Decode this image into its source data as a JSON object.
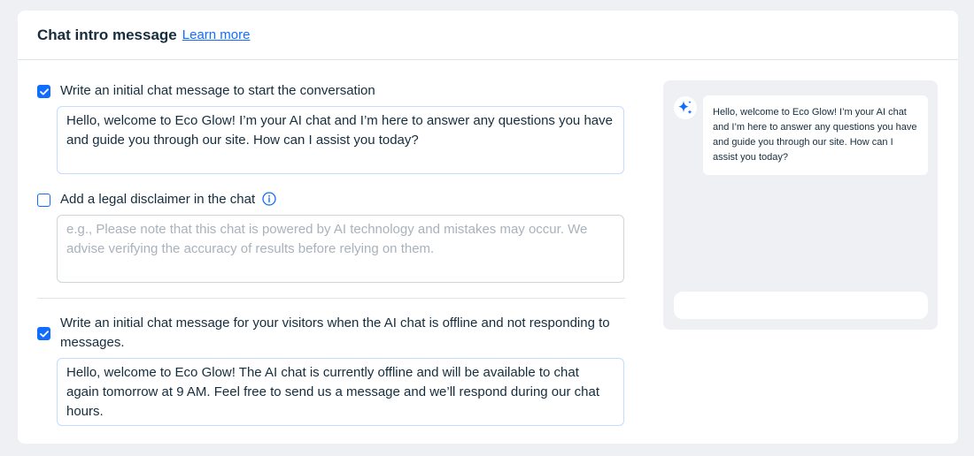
{
  "header": {
    "title": "Chat intro message",
    "learn_more": "Learn more"
  },
  "options": [
    {
      "label": "Write an initial chat message to start the conversation",
      "checked": true,
      "value": "Hello, welcome to Eco Glow! I’m your AI chat and I’m here to answer any questions you have and guide you through our site. How can I assist you today?"
    },
    {
      "label": "Add a legal disclaimer in the chat",
      "checked": false,
      "placeholder": "e.g., Please note that this chat is powered by AI technology and mistakes may occur. We advise verifying the accuracy of results before relying on them."
    },
    {
      "label": "Write an initial chat message for your visitors when the AI chat is offline and not responding to messages.",
      "checked": true,
      "value": "Hello, welcome to Eco Glow! The AI chat is currently offline and will be available to chat again tomorrow at 9 AM. Feel free to send us a message and we’ll respond during our chat hours."
    }
  ],
  "preview": {
    "message": "Hello, welcome to Eco Glow! I’m your AI chat and I’m here to answer any questions you have and guide you through our site. How can I assist you today?",
    "avatar_icon": "sparkle-icon"
  },
  "colors": {
    "accent": "#116dff",
    "page_bg": "#eef0f4",
    "text": "#162d3d",
    "placeholder": "#a9b2bb"
  }
}
